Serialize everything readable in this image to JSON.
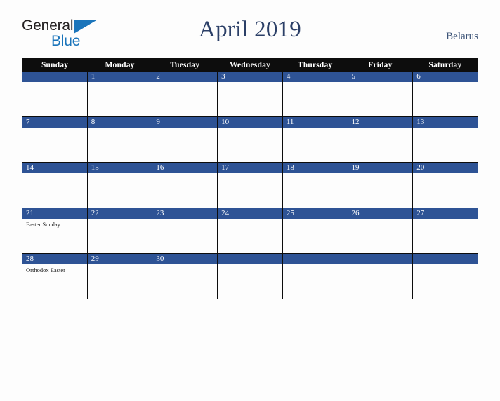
{
  "brand": {
    "name_part1": "General",
    "name_part2": "Blue",
    "color_dark": "#231f20",
    "color_blue": "#1b75bb"
  },
  "header": {
    "title": "April 2019",
    "country": "Belarus",
    "title_color": "#2b3f67",
    "country_color": "#3d5478"
  },
  "calendar": {
    "header_bg": "#0d0d0d",
    "daybar_bg": "#2e5395",
    "cell_bg": "#fdfdfd",
    "weekday_headers": [
      "Sunday",
      "Monday",
      "Tuesday",
      "Wednesday",
      "Thursday",
      "Friday",
      "Saturday"
    ],
    "weeks": [
      [
        {
          "day": "",
          "events": []
        },
        {
          "day": "1",
          "events": []
        },
        {
          "day": "2",
          "events": []
        },
        {
          "day": "3",
          "events": []
        },
        {
          "day": "4",
          "events": []
        },
        {
          "day": "5",
          "events": []
        },
        {
          "day": "6",
          "events": []
        }
      ],
      [
        {
          "day": "7",
          "events": []
        },
        {
          "day": "8",
          "events": []
        },
        {
          "day": "9",
          "events": []
        },
        {
          "day": "10",
          "events": []
        },
        {
          "day": "11",
          "events": []
        },
        {
          "day": "12",
          "events": []
        },
        {
          "day": "13",
          "events": []
        }
      ],
      [
        {
          "day": "14",
          "events": []
        },
        {
          "day": "15",
          "events": []
        },
        {
          "day": "16",
          "events": []
        },
        {
          "day": "17",
          "events": []
        },
        {
          "day": "18",
          "events": []
        },
        {
          "day": "19",
          "events": []
        },
        {
          "day": "20",
          "events": []
        }
      ],
      [
        {
          "day": "21",
          "events": [
            "Easter Sunday"
          ]
        },
        {
          "day": "22",
          "events": []
        },
        {
          "day": "23",
          "events": []
        },
        {
          "day": "24",
          "events": []
        },
        {
          "day": "25",
          "events": []
        },
        {
          "day": "26",
          "events": []
        },
        {
          "day": "27",
          "events": []
        }
      ],
      [
        {
          "day": "28",
          "events": [
            "Orthodox Easter"
          ]
        },
        {
          "day": "29",
          "events": []
        },
        {
          "day": "30",
          "events": []
        },
        {
          "day": "",
          "events": []
        },
        {
          "day": "",
          "events": []
        },
        {
          "day": "",
          "events": []
        },
        {
          "day": "",
          "events": []
        }
      ]
    ]
  }
}
